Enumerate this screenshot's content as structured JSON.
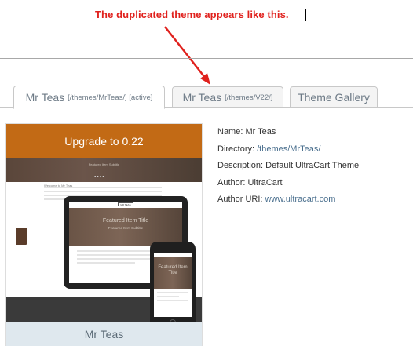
{
  "annotation": {
    "text": "The duplicated theme appears like this.",
    "color": "#e0211d"
  },
  "tabs": [
    {
      "name": "Mr Teas",
      "path": "[/themes/MrTeas/] [active]",
      "active": true
    },
    {
      "name": "Mr Teas",
      "path": "[/themes/V22/]",
      "active": false
    },
    {
      "name": "Theme Gallery",
      "path": "",
      "active": false
    }
  ],
  "theme_card": {
    "upgrade_label": "Upgrade to 0.22",
    "upgrade_color": "#c26a15",
    "theme_name": "Mr Teas",
    "preview": {
      "hero_text": "Featured Item Subtitle",
      "welcome": "Welcome to Mr Teas",
      "tablet_title": "Featured Item Title",
      "tablet_subtitle": "Featured Item Subtitle",
      "phone_title": "Featured Item Title",
      "phone_subtitle": "Featured Item Subtitle",
      "logo": "MR TEAS"
    }
  },
  "details": {
    "name_label": "Name:",
    "name_value": "Mr Teas",
    "directory_label": "Directory:",
    "directory_value": "/themes/MrTeas/",
    "description_label": "Description:",
    "description_value": "Default UltraCart Theme",
    "author_label": "Author:",
    "author_value": "UltraCart",
    "author_uri_label": "Author URI:",
    "author_uri_value": "www.ultracart.com"
  }
}
